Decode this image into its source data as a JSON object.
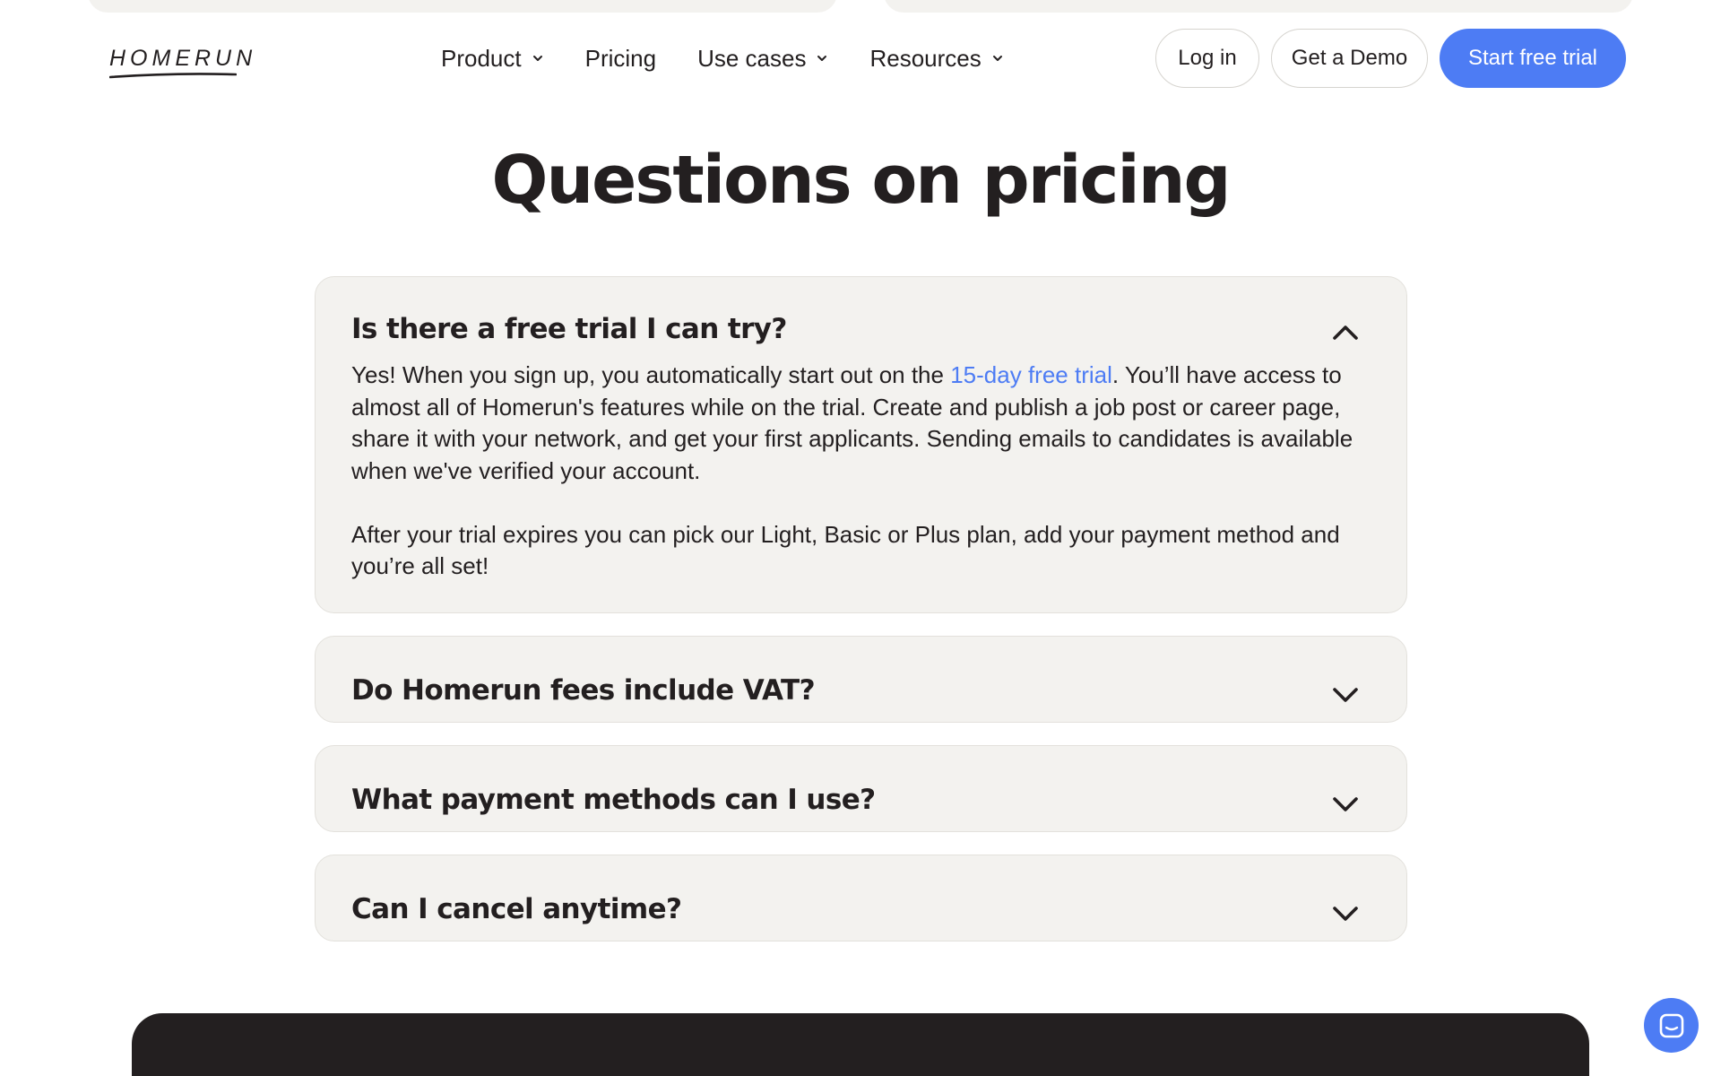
{
  "brand": {
    "logo_text": "HOMERUN",
    "accent_color": "#4d7cf4",
    "dark_color": "#231f20",
    "card_color": "#f3f2ef"
  },
  "nav": {
    "items": [
      {
        "label": "Product",
        "has_dropdown": true
      },
      {
        "label": "Pricing",
        "has_dropdown": false
      },
      {
        "label": "Use cases",
        "has_dropdown": true
      },
      {
        "label": "Resources",
        "has_dropdown": true
      }
    ],
    "login_label": "Log in",
    "demo_label": "Get a Demo",
    "trial_label": "Start free trial"
  },
  "faq": {
    "title": "Questions on pricing",
    "items": [
      {
        "question": "Is there a free trial I can try?",
        "expanded": true,
        "answer_p1_before": "Yes! When you sign up, you automatically start out on the ",
        "answer_p1_link": "15-day free trial",
        "answer_p1_after": ". You’ll have access to almost all of Homerun's features while on the trial. Create and publish a job post or career page, share it with your network, and get your first applicants. Sending emails to candidates is available when we've verified your account.",
        "answer_p2": "After your trial expires you can pick our Light, Basic or Plus plan, add your payment method and you’re all set!"
      },
      {
        "question": "Do Homerun fees include VAT?",
        "expanded": false
      },
      {
        "question": "What payment methods can I use?",
        "expanded": false
      },
      {
        "question": "Can I cancel anytime?",
        "expanded": false
      }
    ]
  },
  "icons": {
    "dropdown": "chevron-down-icon",
    "faq_open": "chevron-up-icon",
    "faq_closed": "chevron-down-icon",
    "chat": "chat-icon"
  }
}
